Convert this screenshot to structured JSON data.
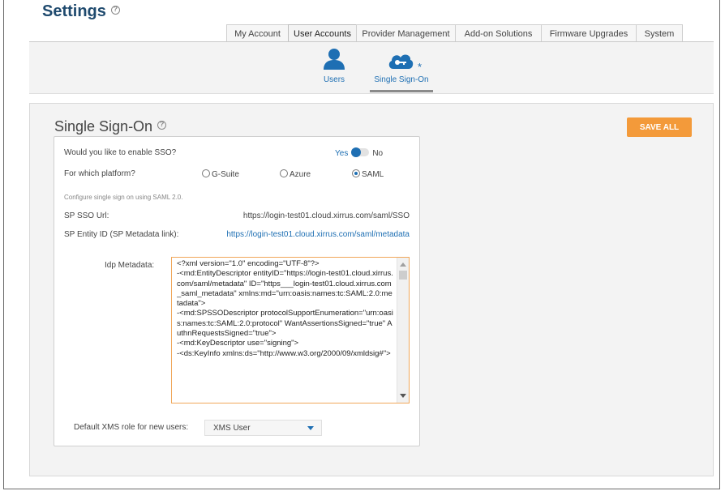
{
  "page": {
    "title": "Settings"
  },
  "tabs": [
    {
      "label": "My Account"
    },
    {
      "label": "User Accounts",
      "active": true
    },
    {
      "label": "Provider Management"
    },
    {
      "label": "Add-on Solutions"
    },
    {
      "label": "Firmware Upgrades"
    },
    {
      "label": "System"
    }
  ],
  "subnav": [
    {
      "label": "Users",
      "icon": "user-icon"
    },
    {
      "label": "Single Sign-On",
      "icon": "cloud-key-icon",
      "active": true,
      "marker": "*"
    }
  ],
  "sso": {
    "title": "Single Sign-On",
    "save_label": "SAVE ALL",
    "enable_question": "Would you like to enable SSO?",
    "yes_label": "Yes",
    "no_label": "No",
    "enabled": true,
    "platform_question": "For which platform?",
    "platforms": [
      {
        "label": "G-Suite",
        "selected": false
      },
      {
        "label": "Azure",
        "selected": false
      },
      {
        "label": "SAML",
        "selected": true
      }
    ],
    "configure_note": "Configure single sign on using SAML 2.0.",
    "sp_sso_url_label": "SP SSO Url:",
    "sp_sso_url_value": "https://login-test01.cloud.xirrus.com/saml/SSO",
    "sp_entity_label": "SP Entity ID (SP Metadata link):",
    "sp_entity_value": "https://login-test01.cloud.xirrus.com/saml/metadata",
    "idp_label": "Idp Metadata:",
    "idp_metadata": "<?xml version=\"1.0\" encoding=\"UTF-8\"?>\n-<md:EntityDescriptor entityID=\"https://login-test01.cloud.xirrus.com/saml/metadata\" ID=\"https___login-test01.cloud.xirrus.com_saml_metadata\" xmlns:md=\"urn:oasis:names:tc:SAML:2.0:metadata\">\n-<md:SPSSODescriptor protocolSupportEnumeration=\"urn:oasis:names:tc:SAML:2.0:protocol\" WantAssertionsSigned=\"true\" AuthnRequestsSigned=\"true\">\n-<md:KeyDescriptor use=\"signing\">\n-<ds:KeyInfo xmlns:ds=\"http://www.w3.org/2000/09/xmldsig#\">",
    "default_role_label": "Default XMS role for new users:",
    "default_role_value": "XMS User"
  },
  "colors": {
    "accent": "#1e6fb3",
    "save": "#f39a3a",
    "title": "#1f4a6e"
  }
}
